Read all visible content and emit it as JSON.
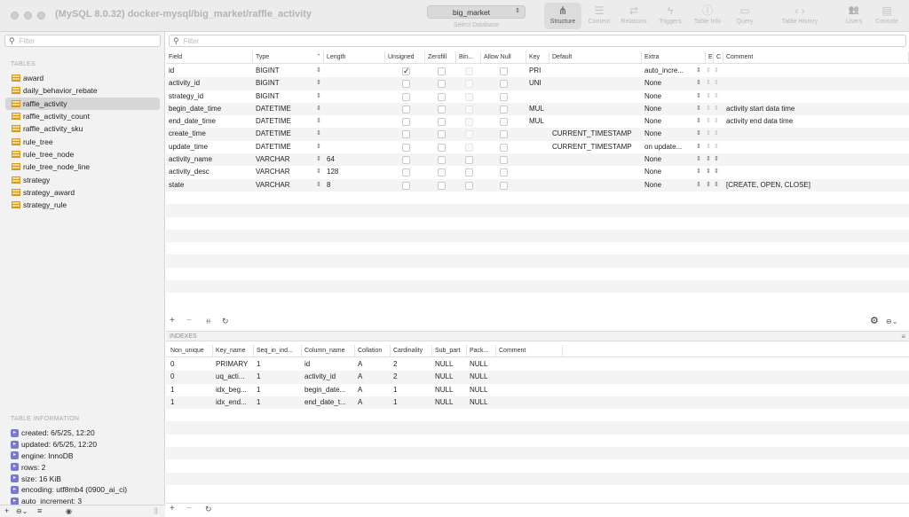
{
  "window": {
    "title": "(MySQL 8.0.32) docker-mysql/big_market/raffle_activity"
  },
  "database_selector": {
    "value": "big_market",
    "label": "Select Database"
  },
  "toolbar": [
    {
      "label": "Structure",
      "icon": "structure-icon",
      "glyph": "⋔",
      "active": true
    },
    {
      "label": "Content",
      "icon": "content-icon",
      "glyph": "☰",
      "active": false
    },
    {
      "label": "Relations",
      "icon": "relations-icon",
      "glyph": "⇄",
      "active": false
    },
    {
      "label": "Triggers",
      "icon": "triggers-icon",
      "glyph": "ϟ",
      "active": false
    },
    {
      "label": "Table Info",
      "icon": "table-info-icon",
      "glyph": "ⓘ",
      "active": false
    },
    {
      "label": "Query",
      "icon": "query-icon",
      "glyph": "▭",
      "active": false
    },
    {
      "label": "Table History",
      "icon": "table-history-icon",
      "glyph": "‹  ›",
      "active": false
    },
    {
      "label": "Users",
      "icon": "users-icon",
      "glyph": "👥",
      "active": false
    },
    {
      "label": "Console",
      "icon": "console-icon",
      "glyph": "▤",
      "active": false
    }
  ],
  "sidebar": {
    "filter_placeholder": "Filter",
    "tables_title": "TABLES",
    "tables": [
      "award",
      "daily_behavior_rebate",
      "raffle_activity",
      "raffle_activity_count",
      "raffle_activity_sku",
      "rule_tree",
      "rule_tree_node",
      "rule_tree_node_line",
      "strategy",
      "strategy_award",
      "strategy_rule"
    ],
    "selected_table": "raffle_activity",
    "info_title": "TABLE INFORMATION",
    "info": [
      "created: 6/5/25, 12:20",
      "updated: 6/5/25, 12:20",
      "engine: InnoDB",
      "rows: 2",
      "size: 16 KiB",
      "encoding: utf8mb4 (0900_ai_ci)",
      "auto_increment: 3"
    ]
  },
  "structure": {
    "filter_placeholder": "Filter",
    "columns": [
      "Field",
      "Type",
      "Length",
      "Unsigned",
      "Zerofill",
      "Binary",
      "Allow Null",
      "Key",
      "Default",
      "Extra",
      "E",
      "C",
      "Comment"
    ],
    "columns_display": [
      "Field",
      "Type",
      "Length",
      "Unsigned",
      "Zerofill",
      "Bin...",
      "Allow Null",
      "Key",
      "Default",
      "Extra",
      "E",
      "C",
      "Comment"
    ],
    "rows": [
      {
        "field": "id",
        "type": "BIGINT",
        "length": "",
        "unsigned": true,
        "key": "PRI",
        "default": "",
        "extra": "auto_incre...",
        "comment": ""
      },
      {
        "field": "activity_id",
        "type": "BIGINT",
        "length": "",
        "unsigned": false,
        "key": "UNI",
        "default": "",
        "extra": "None",
        "comment": ""
      },
      {
        "field": "strategy_id",
        "type": "BIGINT",
        "length": "",
        "unsigned": false,
        "key": "",
        "default": "",
        "extra": "None",
        "comment": ""
      },
      {
        "field": "begin_date_time",
        "type": "DATETIME",
        "length": "",
        "unsigned": false,
        "key": "MUL",
        "default": "",
        "extra": "None",
        "comment": "activity start data time"
      },
      {
        "field": "end_date_time",
        "type": "DATETIME",
        "length": "",
        "unsigned": false,
        "key": "MUL",
        "default": "",
        "extra": "None",
        "comment": "activity end data time"
      },
      {
        "field": "create_time",
        "type": "DATETIME",
        "length": "",
        "unsigned": false,
        "key": "",
        "default": "CURRENT_TIMESTAMP",
        "extra": "None",
        "comment": ""
      },
      {
        "field": "update_time",
        "type": "DATETIME",
        "length": "",
        "unsigned": false,
        "key": "",
        "default": "CURRENT_TIMESTAMP",
        "extra": "on update...",
        "comment": ""
      },
      {
        "field": "activity_name",
        "type": "VARCHAR",
        "length": "64",
        "unsigned": false,
        "key": "",
        "default": "",
        "extra": "None",
        "comment": ""
      },
      {
        "field": "activity_desc",
        "type": "VARCHAR",
        "length": "128",
        "unsigned": false,
        "key": "",
        "default": "",
        "extra": "None",
        "comment": ""
      },
      {
        "field": "state",
        "type": "VARCHAR",
        "length": "8",
        "unsigned": false,
        "key": "",
        "default": "",
        "extra": "None",
        "comment": "[CREATE, OPEN, CLOSE]"
      }
    ]
  },
  "indexes": {
    "title": "INDEXES",
    "columns": [
      "Non_unique",
      "Key_name",
      "Seq_in_ind...",
      "Column_name",
      "Collation",
      "Cardinality",
      "Sub_part",
      "Pack...",
      "Comment"
    ],
    "rows": [
      [
        "0",
        "PRIMARY",
        "1",
        "id",
        "A",
        "2",
        "NULL",
        "NULL",
        ""
      ],
      [
        "0",
        "uq_acti...",
        "1",
        "activity_id",
        "A",
        "2",
        "NULL",
        "NULL",
        ""
      ],
      [
        "1",
        "idx_beg...",
        "1",
        "begin_date...",
        "A",
        "1",
        "NULL",
        "NULL",
        ""
      ],
      [
        "1",
        "idx_end...",
        "1",
        "end_date_t...",
        "A",
        "1",
        "NULL",
        "NULL",
        ""
      ]
    ]
  },
  "actions": {
    "add": "+",
    "remove": "−",
    "duplicate": "⧺",
    "refresh": "↻",
    "gear": "⚙",
    "more": "⊖⌄",
    "eye": "◉",
    "split": "||"
  }
}
